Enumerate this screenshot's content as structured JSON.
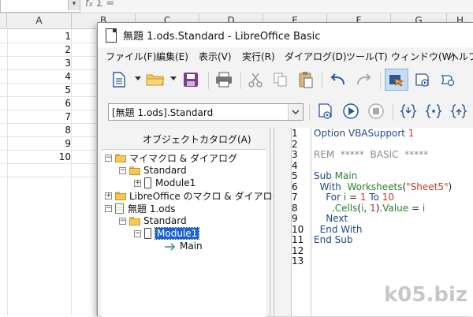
{
  "calc": {
    "column_headers": [
      "A",
      "B",
      "C",
      "D",
      "E",
      "F",
      "G",
      "H"
    ],
    "formula_bar_icons": [
      "fx-icon",
      "sum-icon",
      "equals-icon"
    ],
    "cells_a": [
      "1",
      "2",
      "3",
      "4",
      "5",
      "6",
      "7",
      "8",
      "9",
      "10"
    ]
  },
  "window": {
    "title": "無題 1.ods.Standard - LibreOffice Basic"
  },
  "menu": [
    "ファイル(F)",
    "編集(E)",
    "表示(V)",
    "実行(R)",
    "ダイアログ(D)",
    "ツール(T)",
    "ウィンドウ(W)",
    "ヘルプ"
  ],
  "toolbar": {
    "library_select": "[無題 1.ods].Standard"
  },
  "catalog": {
    "title": "オブジェクトカタログ(A)",
    "tree": [
      {
        "label": "マイマクロ & ダイアログ"
      },
      {
        "label": "Standard"
      },
      {
        "label": "Module1"
      },
      {
        "label": "LibreOffice のマクロ & ダイアログ"
      },
      {
        "label": "無題 1.ods"
      },
      {
        "label": "Standard"
      },
      {
        "label": "Module1"
      },
      {
        "label": "Main"
      }
    ]
  },
  "editor": {
    "line_numbers": [
      "1",
      "2",
      "3",
      "4",
      "5",
      "6",
      "7",
      "8",
      "9",
      "10",
      "11",
      "12",
      "13"
    ],
    "code": [
      {
        "parts": [
          [
            "kw",
            "Option VBASupport "
          ],
          [
            "num",
            "1"
          ]
        ]
      },
      {
        "parts": []
      },
      {
        "parts": [
          [
            "cm",
            "REM  *****  BASIC  *****"
          ]
        ]
      },
      {
        "parts": []
      },
      {
        "parts": [
          [
            "kw",
            "Sub "
          ],
          [
            "id",
            "Main"
          ]
        ]
      },
      {
        "parts": [
          [
            "kw",
            "  With  "
          ],
          [
            "id",
            "Worksheets"
          ],
          [
            "op",
            "("
          ],
          [
            "str",
            "\"Sheet5\""
          ],
          [
            "op",
            ")"
          ]
        ]
      },
      {
        "parts": [
          [
            "kw",
            "    For "
          ],
          [
            "id",
            "i"
          ],
          [
            "op",
            " = "
          ],
          [
            "num",
            "1"
          ],
          [
            "kw",
            " To "
          ],
          [
            "num",
            "10"
          ]
        ]
      },
      {
        "parts": [
          [
            "op",
            "      ."
          ],
          [
            "id",
            "Cells"
          ],
          [
            "op",
            "("
          ],
          [
            "id",
            "i"
          ],
          [
            "op",
            ", "
          ],
          [
            "num",
            "1"
          ],
          [
            "op",
            ")."
          ],
          [
            "id",
            "Value"
          ],
          [
            "op",
            " = "
          ],
          [
            "id",
            "i"
          ]
        ]
      },
      {
        "parts": [
          [
            "kw",
            "    Next"
          ]
        ]
      },
      {
        "parts": [
          [
            "kw",
            "  End With"
          ]
        ]
      },
      {
        "parts": [
          [
            "kw",
            "End Sub"
          ]
        ]
      },
      {
        "parts": []
      },
      {
        "parts": []
      }
    ]
  },
  "watermark": "k05.biz",
  "colors": {
    "selection": "#1c64d6",
    "keyword": "#204a87",
    "identifier": "#2c7d2c",
    "string": "#c0392b",
    "comment": "#8a8a8a"
  }
}
